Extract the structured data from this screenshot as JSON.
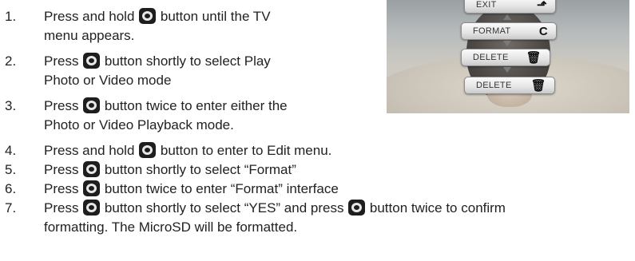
{
  "steps": [
    {
      "num": "1.",
      "lines": [
        [
          "Press and hold ",
          "{icon}",
          " button until the TV"
        ],
        [
          "menu appears."
        ]
      ]
    },
    {
      "num": "2.",
      "lines": [
        [
          "Press ",
          "{icon}",
          " button shortly to select Play"
        ],
        [
          "Photo or Video mode"
        ]
      ]
    },
    {
      "num": "3.",
      "lines": [
        [
          "Press ",
          "{icon}",
          " button twice to enter either the"
        ],
        [
          "Photo or Video Playback mode."
        ]
      ]
    },
    {
      "num": "4.",
      "lines": [
        [
          "Press and hold ",
          "{icon}",
          " button to enter to Edit menu."
        ]
      ]
    },
    {
      "num": "5.",
      "lines": [
        [
          "Press ",
          "{icon}",
          " button shortly to select “Format”"
        ]
      ]
    },
    {
      "num": "6.",
      "lines": [
        [
          "Press ",
          "{icon}",
          " button twice to enter “Format” interface"
        ]
      ]
    },
    {
      "num": "7.",
      "lines": [
        [
          "Press ",
          "{icon}",
          " button shortly to select “YES” and press ",
          "{icon}",
          " button twice to confirm"
        ],
        [
          "formatting. The MicroSD will be formatted."
        ]
      ]
    }
  ],
  "photo_menu": {
    "items": [
      {
        "label": "EXIT",
        "icon": "exit-icon",
        "glyph": "⬏"
      },
      {
        "label": "FORMAT",
        "icon": "format-icon",
        "glyph": "C"
      },
      {
        "label": "DELETE",
        "icon": "trash-icon",
        "glyph": "🗑"
      },
      {
        "label": "DELETE",
        "icon": "trash-all-icon",
        "glyph": "🗑"
      }
    ]
  },
  "icons": {
    "camera_button": "camera-button-icon"
  },
  "colors": {
    "text": "#222222",
    "icon": "#1e1e1e"
  }
}
